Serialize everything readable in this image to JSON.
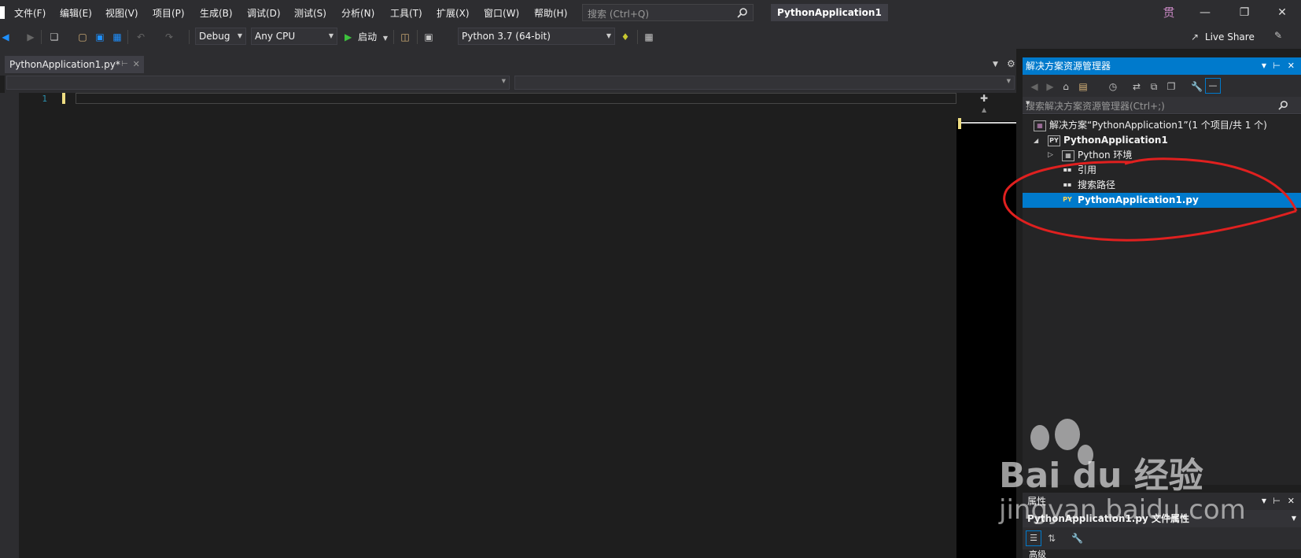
{
  "menu": {
    "items": [
      "文件(F)",
      "编辑(E)",
      "视图(V)",
      "项目(P)",
      "生成(B)",
      "调试(D)",
      "测试(S)",
      "分析(N)",
      "工具(T)",
      "扩展(X)",
      "窗口(W)",
      "帮助(H)"
    ],
    "search_placeholder": "搜索 (Ctrl+Q)",
    "window_title": "PythonApplication1",
    "user_initial": "贯"
  },
  "toolbar": {
    "config": "Debug",
    "platform": "Any CPU",
    "start_label": "启动",
    "environment": "Python 3.7 (64-bit)",
    "live_share": "Live Share"
  },
  "editor": {
    "tab_label": "PythonApplication1.py*",
    "line_number": "1"
  },
  "solution_explorer": {
    "title": "解决方案资源管理器",
    "search_placeholder": "搜索解决方案资源管理器(Ctrl+;)",
    "tree": [
      {
        "label": "解决方案“PythonApplication1”(1 个项目/共 1 个)",
        "icon": "solution-icon",
        "indent": 0
      },
      {
        "label": "PythonApplication1",
        "icon": "python-project-icon",
        "indent": 1,
        "bold": true
      },
      {
        "label": "Python 环境",
        "icon": "environment-icon",
        "indent": 2
      },
      {
        "label": "引用",
        "icon": "references-icon",
        "indent": 2
      },
      {
        "label": "搜索路径",
        "icon": "search-paths-icon",
        "indent": 2
      },
      {
        "label": "PythonApplication1.py",
        "icon": "python-file-icon",
        "indent": 2,
        "selected": true
      }
    ]
  },
  "properties": {
    "title": "属性",
    "object": "PythonApplication1.py 文件属性",
    "section": "高级"
  },
  "watermark": {
    "brand": "Bai du 经验",
    "url": "jingyan.baidu.com"
  },
  "colors": {
    "accent": "#007acc",
    "annotation": "#e0201f",
    "background": "#1e1e1e",
    "chrome": "#2d2d30"
  }
}
